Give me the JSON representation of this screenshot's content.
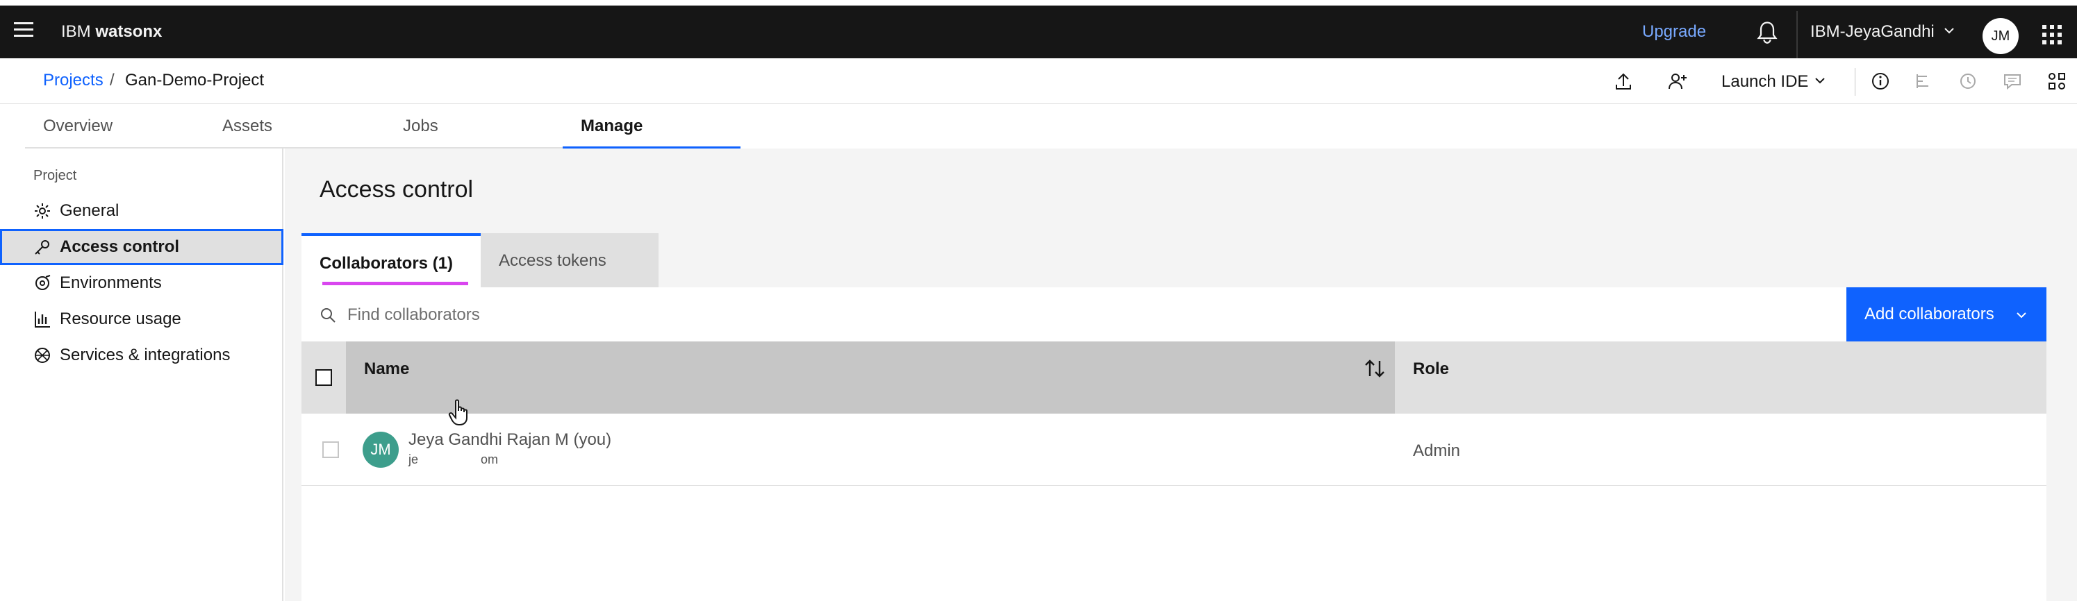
{
  "topbar": {
    "brand_prefix": "IBM",
    "brand_name": "watsonx",
    "upgrade": "Upgrade",
    "account": "IBM-JeyaGandhi",
    "avatar": "JM",
    "icons": [
      "menu-icon",
      "notification-icon",
      "chevron-down-icon",
      "app-switcher-icon"
    ]
  },
  "breadcrumb": {
    "link": "Projects",
    "separator": "/",
    "current": "Gan-Demo-Project"
  },
  "header_actions": {
    "launch_ide": "Launch IDE",
    "icons": [
      "upload-icon",
      "add-user-icon",
      "info-icon",
      "flow-icon",
      "history-icon",
      "comment-icon",
      "settings-group-icon"
    ]
  },
  "tabs": [
    {
      "label": "Overview",
      "active": false
    },
    {
      "label": "Assets",
      "active": false
    },
    {
      "label": "Jobs",
      "active": false
    },
    {
      "label": "Manage",
      "active": true
    }
  ],
  "sidebar": {
    "heading": "Project",
    "items": [
      {
        "label": "General",
        "icon": "gear-icon",
        "active": false
      },
      {
        "label": "Access control",
        "icon": "key-icon",
        "active": true
      },
      {
        "label": "Environments",
        "icon": "environment-icon",
        "active": false
      },
      {
        "label": "Resource usage",
        "icon": "chart-bar-icon",
        "active": false
      },
      {
        "label": "Services & integrations",
        "icon": "integrations-icon",
        "active": false
      }
    ]
  },
  "main": {
    "title": "Access control",
    "content_tabs": [
      {
        "label": "Collaborators (1)",
        "active": true
      },
      {
        "label": "Access tokens",
        "active": false
      }
    ],
    "search": {
      "placeholder": "Find collaborators",
      "value": ""
    },
    "add_button": "Add collaborators",
    "table": {
      "columns": [
        "Name",
        "Role"
      ],
      "rows": [
        {
          "avatar": "JM",
          "name": "Jeya Gandhi Rajan M (you)",
          "email": "je                  om",
          "role": "Admin"
        }
      ]
    }
  },
  "colors": {
    "topbar_bg": "#161616",
    "accent": "#0f62fe",
    "upgrade": "#78a9ff",
    "avatar_teal": "#3d9e8c",
    "tab_underline_magenta": "#d946ef"
  }
}
